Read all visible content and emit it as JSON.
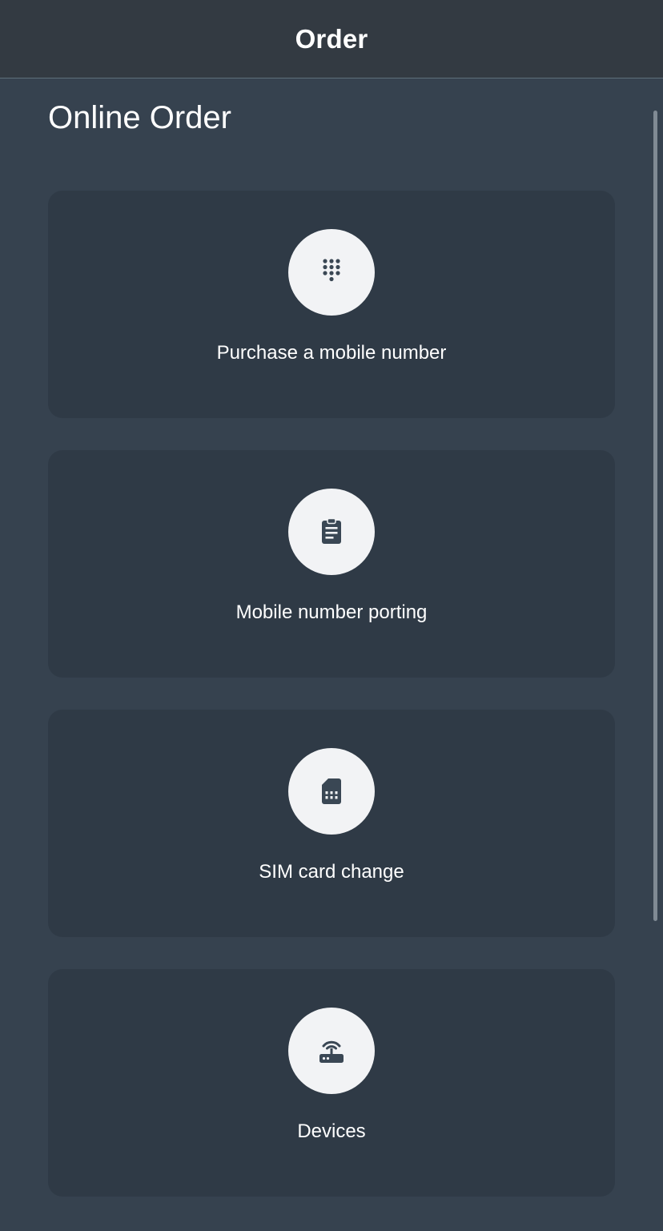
{
  "header": {
    "title": "Order"
  },
  "page": {
    "title": "Online Order"
  },
  "cards": [
    {
      "label": "Purchase a mobile number",
      "icon": "dialpad-icon"
    },
    {
      "label": "Mobile number porting",
      "icon": "clipboard-icon"
    },
    {
      "label": "SIM card change",
      "icon": "sim-card-icon"
    },
    {
      "label": "Devices",
      "icon": "router-icon"
    }
  ],
  "colors": {
    "background": "#36424f",
    "header": "#333a42",
    "card": "#2f3a46",
    "icon_circle": "#f2f3f5",
    "icon": "#3a4754"
  }
}
